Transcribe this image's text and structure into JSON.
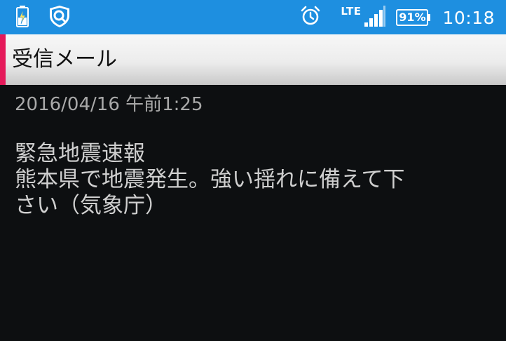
{
  "status_bar": {
    "network": "LTE",
    "battery": "91%",
    "time": "10:18",
    "icons": [
      "battery-charging-icon",
      "security-app-icon",
      "alarm-icon",
      "signal-icon",
      "battery-icon"
    ],
    "color": "#1e8fe0"
  },
  "app_bar": {
    "title": "受信メール",
    "accent_color": "#e5195a"
  },
  "message": {
    "date": "2016/04/16 午前1:25",
    "lines": [
      "緊急地震速報",
      "熊本県で地震発生。強い揺れに備えて下",
      "さい（気象庁）"
    ]
  }
}
